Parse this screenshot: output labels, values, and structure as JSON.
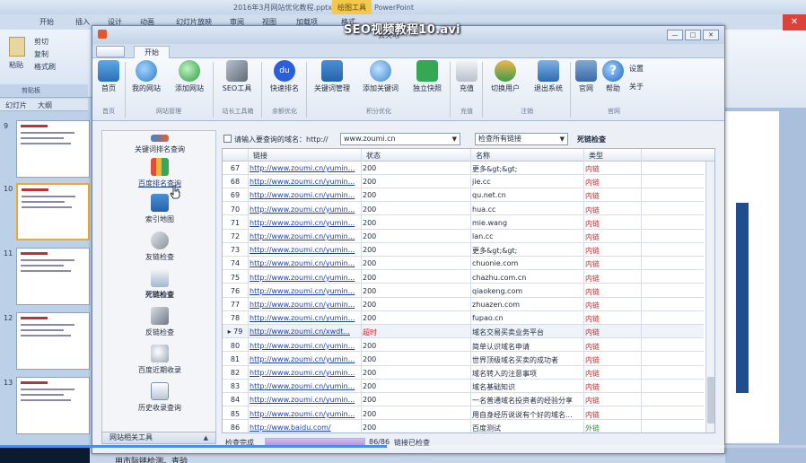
{
  "video": {
    "title": "SEO视频教程10.avi",
    "progress": 0.48
  },
  "ppt": {
    "title": "2016年3月网站优化教程.pptx - Microsoft PowerPoint",
    "context_tab": "绘图工具",
    "tabs": [
      "开始",
      "插入",
      "设计",
      "动画",
      "幻灯片放映",
      "审阅",
      "视图",
      "加载项",
      "格式"
    ],
    "ribbon_buttons": {
      "paste": "粘贴",
      "cut": "剪切",
      "copy": "复制",
      "format_painter": "格式刷",
      "clipboard": "剪贴板"
    },
    "side_tabs": [
      "幻灯片",
      "大纲"
    ],
    "thumb_numbers": [
      "9",
      "10",
      "11",
      "12",
      "13"
    ],
    "bottom_text": "用市际链检测。查验"
  },
  "window": {
    "title": "丢失地",
    "tab": "开始",
    "toolbar": [
      {
        "label": "首页",
        "icon": "home-icon",
        "cls": "ic-home",
        "glyph": ""
      },
      {
        "label": "我的网站",
        "icon": "globe-icon",
        "cls": "ic-site",
        "glyph": ""
      },
      {
        "label": "添加网站",
        "icon": "add-globe-icon",
        "cls": "ic-add",
        "glyph": ""
      },
      {
        "label": "SEO工具",
        "icon": "tools-icon",
        "cls": "ic-tool",
        "glyph": ""
      },
      {
        "label": "快速排名",
        "icon": "baidu-paw-icon",
        "cls": "ic-baidu",
        "glyph": "du"
      },
      {
        "label": "关键词管理",
        "icon": "tree-icon",
        "cls": "ic-tree",
        "glyph": ""
      },
      {
        "label": "添加关键词",
        "icon": "add-keyword-icon",
        "cls": "ic-kw",
        "glyph": ""
      },
      {
        "label": "独立快照",
        "icon": "plus-icon",
        "cls": "ic-plus",
        "glyph": ""
      },
      {
        "label": "充值",
        "icon": "recharge-icon",
        "cls": "ic-recharge",
        "glyph": ""
      },
      {
        "label": "切换用户",
        "icon": "switch-user-icon",
        "cls": "ic-user",
        "glyph": ""
      },
      {
        "label": "退出系统",
        "icon": "exit-icon",
        "cls": "ic-exit",
        "glyph": ""
      },
      {
        "label": "官网",
        "icon": "chat-icon",
        "cls": "ic-chat",
        "glyph": ""
      },
      {
        "label": "帮助",
        "icon": "help-icon",
        "cls": "ic-help",
        "glyph": "?"
      }
    ],
    "toolbar_extra": {
      "settings": "设置",
      "about": "关于"
    },
    "groups": [
      "首页",
      "网站管理",
      "站长工具箱",
      "余额优化",
      "积分优化",
      "充值",
      "注销",
      "官网"
    ],
    "left_panel": {
      "items": [
        {
          "label": "关键词排名查询",
          "icon": "keyword-rank-icon"
        },
        {
          "label": "百度排名查询",
          "icon": "bar-chart-icon"
        },
        {
          "label": "索引地图",
          "icon": "sitemap-icon"
        },
        {
          "label": "友链检查",
          "icon": "chain-icon"
        },
        {
          "label": "死链检查",
          "icon": "broken-link-icon"
        },
        {
          "label": "反链检查",
          "icon": "backlink-icon"
        },
        {
          "label": "百度近期收录",
          "icon": "magnifier-icon"
        },
        {
          "label": "历史收录查询",
          "icon": "history-icon"
        }
      ],
      "footer": "网站相关工具"
    },
    "query": {
      "label": "请输入要查询的域名：http://",
      "domain": "www.zoumi.cn",
      "scope": "检查所有链接",
      "mode": "死链检查"
    },
    "table": {
      "columns": [
        "",
        "链接",
        "状态",
        "名称",
        "类型"
      ],
      "rows": [
        {
          "idx": "67",
          "link": "http://www.zoumi.cn/yumin...",
          "status": "200",
          "name": "更多&gt;&gt;",
          "type": "内链"
        },
        {
          "idx": "68",
          "link": "http://www.zoumi.cn/yumin...",
          "status": "200",
          "name": "jie.cc",
          "type": "内链"
        },
        {
          "idx": "69",
          "link": "http://www.zoumi.cn/yumin...",
          "status": "200",
          "name": "qu.net.cn",
          "type": "内链"
        },
        {
          "idx": "70",
          "link": "http://www.zoumi.cn/yumin...",
          "status": "200",
          "name": "hua.cc",
          "type": "内链"
        },
        {
          "idx": "71",
          "link": "http://www.zoumi.cn/yumin...",
          "status": "200",
          "name": "mie.wang",
          "type": "内链"
        },
        {
          "idx": "72",
          "link": "http://www.zoumi.cn/yumin...",
          "status": "200",
          "name": "lan.cc",
          "type": "内链"
        },
        {
          "idx": "73",
          "link": "http://www.zoumi.cn/yumin...",
          "status": "200",
          "name": "更多&gt;&gt;",
          "type": "内链"
        },
        {
          "idx": "74",
          "link": "http://www.zoumi.cn/yumin...",
          "status": "200",
          "name": "chuonie.com",
          "type": "内链"
        },
        {
          "idx": "75",
          "link": "http://www.zoumi.cn/yumin...",
          "status": "200",
          "name": "chazhu.com.cn",
          "type": "内链"
        },
        {
          "idx": "76",
          "link": "http://www.zoumi.cn/yumin...",
          "status": "200",
          "name": "qiaokeng.com",
          "type": "内链"
        },
        {
          "idx": "77",
          "link": "http://www.zoumi.cn/yumin...",
          "status": "200",
          "name": "zhuazen.com",
          "type": "内链"
        },
        {
          "idx": "78",
          "link": "http://www.zoumi.cn/yumin...",
          "status": "200",
          "name": "fupao.cn",
          "type": "内链"
        },
        {
          "idx": "▸ 79",
          "link": "http://www.zoumi.cn/xwdt...",
          "status": "超时",
          "name": "域名交易买卖业务平台",
          "type": "内链"
        },
        {
          "idx": "80",
          "link": "http://www.zoumi.cn/yumin...",
          "status": "200",
          "name": "简单认识域名申请",
          "type": "内链"
        },
        {
          "idx": "81",
          "link": "http://www.zoumi.cn/yumin...",
          "status": "200",
          "name": "世界顶级域名买卖的成功者",
          "type": "内链"
        },
        {
          "idx": "82",
          "link": "http://www.zoumi.cn/yumin...",
          "status": "200",
          "name": "域名转入的注意事项",
          "type": "内链"
        },
        {
          "idx": "83",
          "link": "http://www.zoumi.cn/yumin...",
          "status": "200",
          "name": "域名基础知识",
          "type": "内链"
        },
        {
          "idx": "84",
          "link": "http://www.zoumi.cn/yumin...",
          "status": "200",
          "name": "一名普通域名投资者的经验分享",
          "type": "内链"
        },
        {
          "idx": "85",
          "link": "http://www.zoumi.cn/yumin...",
          "status": "200",
          "name": "用自身经历说说有个好的域名...",
          "type": "内链"
        },
        {
          "idx": "86",
          "link": "http://www.baidu.com/",
          "status": "200",
          "name": "百度测试",
          "type": "外链"
        }
      ]
    },
    "status": {
      "left": "检查完成",
      "progress": 1.0,
      "count": "86/86",
      "right": "链接已检查"
    },
    "colors": {
      "timeout": "#d02020",
      "internal": "#d02020",
      "external": "#2f8d2f",
      "link": "#1a3fae"
    }
  }
}
